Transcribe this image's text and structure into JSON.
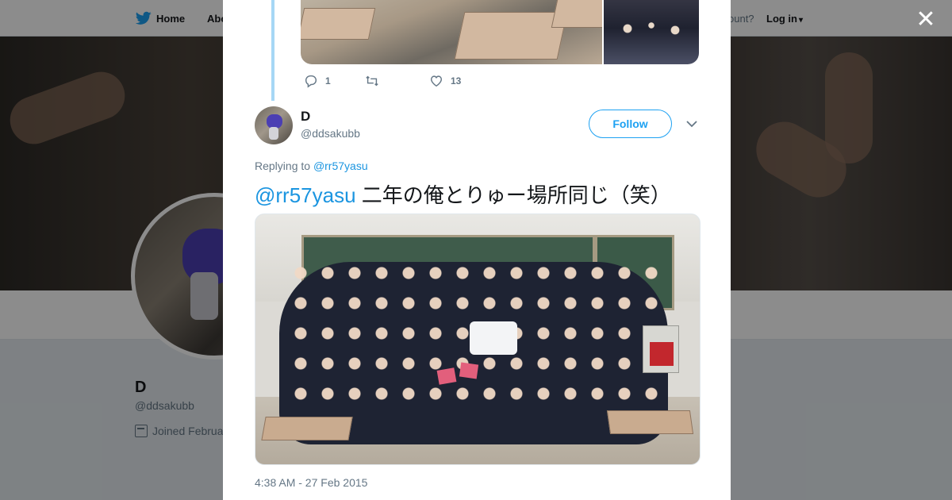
{
  "background": {
    "nav": {
      "home_label": "Home",
      "about_label": "Abo",
      "account_text": "ccount?",
      "login_label": "Log in"
    },
    "profile": {
      "name": "D",
      "handle": "@ddsakubb",
      "joined": "Joined Februa"
    }
  },
  "modal": {
    "close_icon": "close-icon",
    "previous_tweet": {
      "reply_count": "1",
      "retweet_count": "",
      "like_count": "13"
    },
    "tweet": {
      "name": "D",
      "handle": "@ddsakubb",
      "follow_label": "Follow",
      "replying_prefix": "Replying to",
      "replying_to": "@rr57yasu",
      "text_mention": "@rr57yasu",
      "text_body": " 二年の俺とりゅー場所同じ（笑）",
      "timestamp": "4:38 AM - 27 Feb 2015"
    }
  },
  "colors": {
    "brand": "#1da1f2",
    "link": "#1b95e0",
    "thread_line": "#a6d7f5",
    "secondary_text": "#657786"
  }
}
